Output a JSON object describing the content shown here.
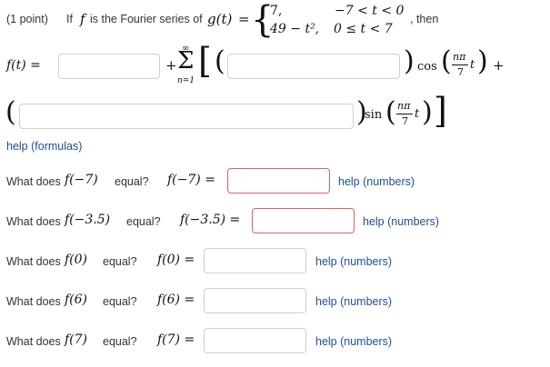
{
  "problem": {
    "points": "(1 point)",
    "intro": "If",
    "f_var": "f",
    "is_text": "is the Fourier series of",
    "g_expr": "g(t)",
    "eq": "=",
    "piece1_value": "7,",
    "piece1_cond": "−7 < t < 0",
    "piece2_value": "49 − t²,",
    "piece2_cond": "0 ≤ t < 7",
    "then": ", then"
  },
  "series": {
    "lhs": "f(t) =",
    "plus": "+",
    "sum_top": "∞",
    "sum_sym": "Σ",
    "sum_bottom": "n=1",
    "cos_label": "cos",
    "sin_label": "sin",
    "arg_num": "nπ",
    "arg_den": "7",
    "arg_t": "t",
    "trailing_plus": "+"
  },
  "inputs": {
    "a0": "",
    "an": "",
    "bn": ""
  },
  "help_formulas": "help (formulas)",
  "questions": [
    {
      "prompt": "What does",
      "expr": "f(−7)",
      "tail": "equal?",
      "lhs": "f(−7) =",
      "value": "",
      "help": "help (numbers)"
    },
    {
      "prompt": "What does",
      "expr": "f(−3.5)",
      "tail": "equal?",
      "lhs": "f(−3.5) =",
      "value": "",
      "help": "help (numbers)"
    },
    {
      "prompt": "What does",
      "expr": "f(0)",
      "tail": "equal?",
      "lhs": "f(0) =",
      "value": "",
      "help": "help (numbers)"
    },
    {
      "prompt": "What does",
      "expr": "f(6)",
      "tail": "equal?",
      "lhs": "f(6) =",
      "value": "",
      "help": "help (numbers)"
    },
    {
      "prompt": "What does",
      "expr": "f(7)",
      "tail": "equal?",
      "lhs": "f(7) =",
      "value": "",
      "help": "help (numbers)"
    }
  ],
  "colors": {
    "link": "#1f4f8f",
    "error_border": "#e06060",
    "input_border": "#d0d0d0"
  }
}
